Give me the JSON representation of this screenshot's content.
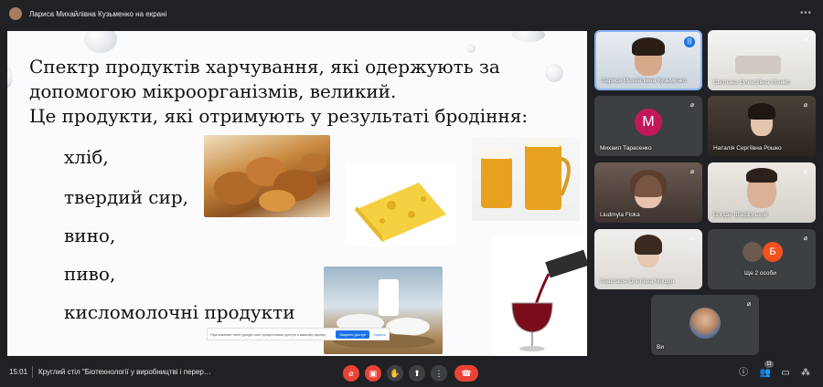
{
  "topbar": {
    "presenter_title": "Лариса Михайлівна Кузьменко на екрані",
    "more_icon": "more-horizontal-icon"
  },
  "slide": {
    "heading_line1": "Спектр продуктів харчування, які одержують за",
    "heading_line2": "допомогою мікроорганізмів, великий.",
    "heading_line3": "Це продукти, які отримують у результаті бродіння:",
    "items": [
      "хліб,",
      "твердий сир,",
      "вино,",
      "пиво,",
      "кисломолочні продукти"
    ]
  },
  "share_notice": {
    "message": "Приложение meet.google.com предоставил доступ к вашему экрану.",
    "stop_label": "Закрыть доступ",
    "hide_label": "Скрыть"
  },
  "participants": [
    {
      "name": "Лариса Михайлівна Кузьменко",
      "state": "speaking"
    },
    {
      "name": "Світлана Олексіївна Усенко",
      "state": "muted"
    },
    {
      "name": "Михаил Тарасенко",
      "state": "muted",
      "avatar_letter": "M",
      "avatar_color": "#c2185b"
    },
    {
      "name": "Наталія Сергіївна Рошко",
      "state": "muted"
    },
    {
      "name": "Liudmyla Floka",
      "state": "muted"
    },
    {
      "name": "Богдан Шафірський",
      "state": "muted"
    },
    {
      "name": "Анастасія Олегівна Мишун",
      "state": "muted"
    },
    {
      "name": "Ще 2 особи",
      "state": "muted",
      "avatar_letter": "Б",
      "avatar_color": "#f4511e"
    },
    {
      "name": "Ви",
      "state": "muted"
    }
  ],
  "bottombar": {
    "time": "15:01",
    "meeting_title": "Круглий стіл \"Біотехнології у виробництві і перер…",
    "participants_count": "11",
    "controls": [
      "mic-off-icon",
      "camera-off-icon",
      "raise-hand-icon",
      "present-icon",
      "more-vert-icon",
      "hang-up-icon"
    ],
    "right_icons": [
      "info-icon",
      "people-icon",
      "chat-icon",
      "activities-icon"
    ]
  },
  "colors": {
    "background": "#202124",
    "tile": "#3c4043",
    "danger": "#ea4335",
    "accent": "#1a73e8"
  }
}
